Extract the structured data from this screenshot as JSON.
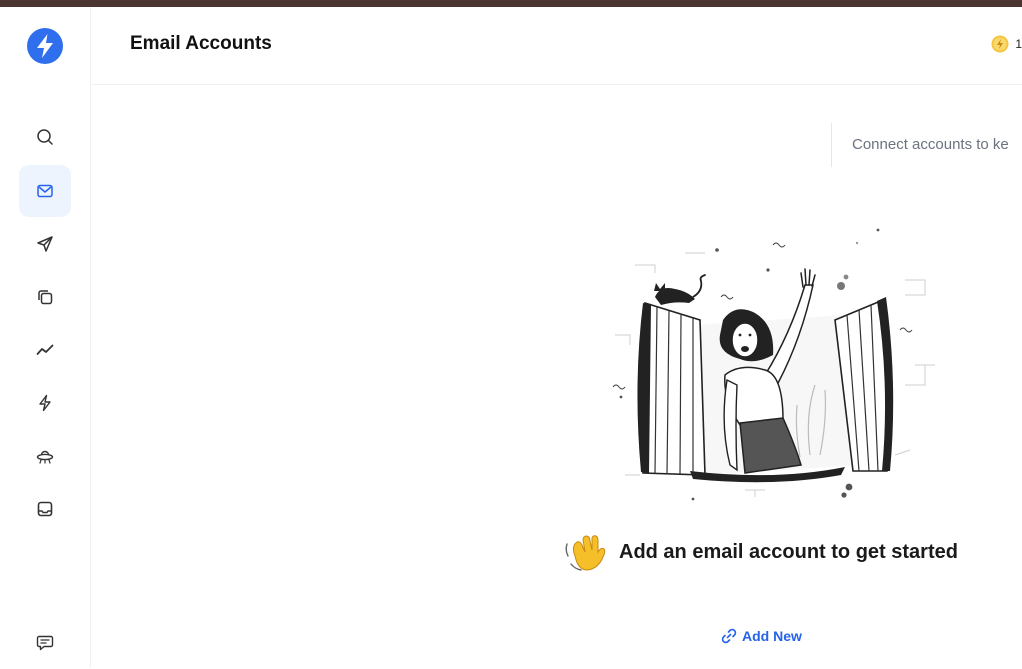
{
  "header": {
    "title": "Email Accounts",
    "credits": "1"
  },
  "sidebar": {
    "items": [
      {
        "name": "search"
      },
      {
        "name": "email-accounts",
        "active": true
      },
      {
        "name": "campaigns"
      },
      {
        "name": "templates"
      },
      {
        "name": "analytics"
      },
      {
        "name": "automations"
      },
      {
        "name": "leads"
      },
      {
        "name": "inbox"
      }
    ],
    "bottom_item": "feedback"
  },
  "main": {
    "hint": "Connect accounts to ke",
    "empty_title": "Add an email account to get started",
    "add_new_label": "Add New"
  },
  "colors": {
    "brand": "#2f6fed",
    "accent": "#2563eb",
    "active_bg": "#eef4fe",
    "topbar": "#4a3531"
  }
}
